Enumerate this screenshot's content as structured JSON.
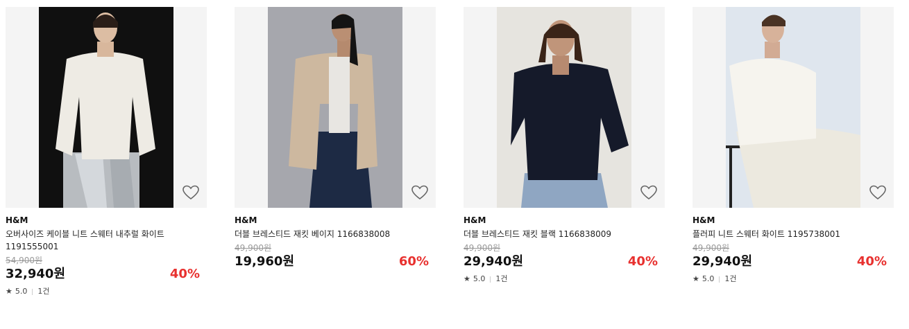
{
  "products": [
    {
      "brand": "H&M",
      "name": "오버사이즈 케이블 니트 스웨터 내추럴 화이트 1191555001",
      "original_price": "54,900원",
      "price": "32,940원",
      "discount": "40%",
      "rating": "5.0",
      "review_count": "1건",
      "star": "★",
      "photo": "woman-white-cable-knit-sweater-silver-pants",
      "bg": "#111111"
    },
    {
      "brand": "H&M",
      "name": "더블 브레스티드 재킷 베이지 1166838008",
      "original_price": "49,900원",
      "price": "19,960원",
      "discount": "60%",
      "rating": "",
      "review_count": "",
      "star": "",
      "photo": "woman-beige-blazer-jeans",
      "bg": "#a6a7ad"
    },
    {
      "brand": "H&M",
      "name": "더블 브레스티드 재킷 블랙 1166838009",
      "original_price": "49,900원",
      "price": "29,940원",
      "discount": "40%",
      "rating": "5.0",
      "review_count": "1건",
      "star": "★",
      "photo": "woman-black-blazer-jeans",
      "bg": "#e6e4df"
    },
    {
      "brand": "H&M",
      "name": "플러피 니트 스웨터 화이트 1195738001",
      "original_price": "49,900원",
      "price": "29,940원",
      "discount": "40%",
      "rating": "5.0",
      "review_count": "1건",
      "star": "★",
      "photo": "woman-white-fluffy-sweater-pearl-skirt",
      "bg": "#dfe6ee"
    }
  ],
  "colors": {
    "discount": "#e8312f",
    "original_price": "#999999"
  }
}
